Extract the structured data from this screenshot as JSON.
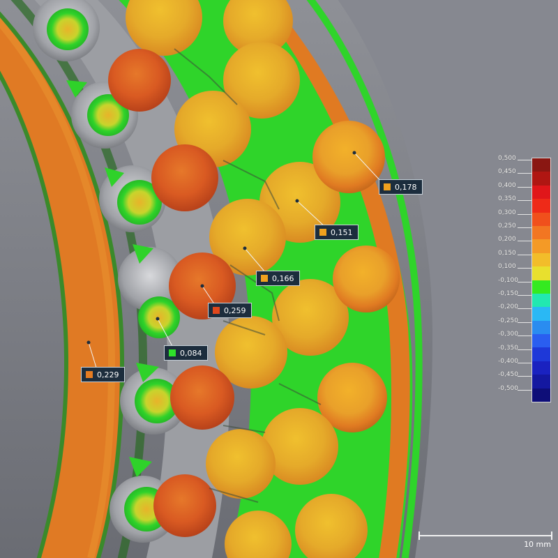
{
  "colors": {
    "background": "#7f8188",
    "callout_bg": "#1c2d3d",
    "callout_border": "#c9d3db",
    "green": "#2fe02a",
    "yellow": "#e8c62a",
    "orange": "#e07a22",
    "red": "#d8331c",
    "gray_surface": "#a9abaf"
  },
  "callouts": [
    {
      "label": "0,178",
      "color": "#f0a21e"
    },
    {
      "label": "0,151",
      "color": "#f0a21e"
    },
    {
      "label": "0,166",
      "color": "#f0a21e"
    },
    {
      "label": "0,259",
      "color": "#e0471c"
    },
    {
      "label": "0,084",
      "color": "#2fe02a"
    },
    {
      "label": "0,229",
      "color": "#e57c22"
    }
  ],
  "legend": {
    "ticks": [
      "0,500",
      "0,450",
      "0,400",
      "0,350",
      "0,300",
      "0,250",
      "0,200",
      "0,150",
      "0,100",
      "-0,100",
      "-0,150",
      "-0,200",
      "-0,250",
      "-0,300",
      "-0,350",
      "-0,400",
      "-0,450",
      "-0,500"
    ],
    "colors": [
      "#8a1712",
      "#b01612",
      "#e0161a",
      "#ee2a18",
      "#f0501c",
      "#f27622",
      "#f49a26",
      "#f2bd2a",
      "#e8e02e",
      "#34ea20",
      "#22e8b0",
      "#2ab8f4",
      "#2a8cf0",
      "#2a5ef0",
      "#1e38d8",
      "#1a22c0",
      "#1418a0",
      "#0e0e78"
    ]
  },
  "scalebar": {
    "label": "10 mm"
  }
}
